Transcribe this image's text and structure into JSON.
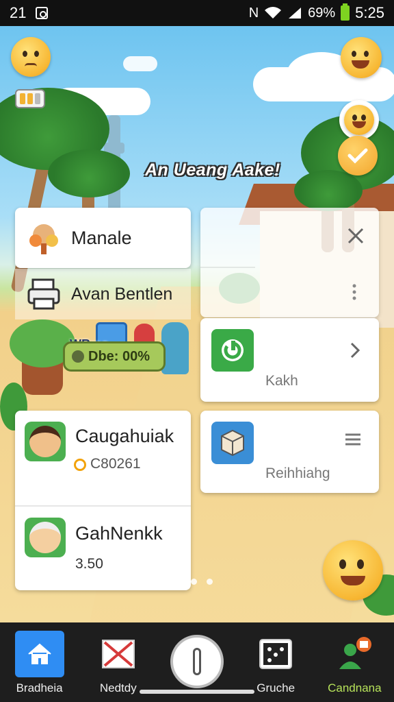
{
  "status_bar": {
    "left_text": "21",
    "battery": "69%",
    "time": "5:25"
  },
  "scene": {
    "headline": "An Ueang Aake!"
  },
  "menu": {
    "items": [
      {
        "label": "Manale"
      },
      {
        "label": "Avan Bentlen"
      }
    ],
    "card_overlay": {
      "tag": "WRmo",
      "pill_text": "Dbe: 00%"
    }
  },
  "apps": {
    "kakh": {
      "label": "Kakh"
    },
    "reihhiahg": {
      "label": "Reihhiahg"
    }
  },
  "contacts": [
    {
      "name": "Caugahuiak",
      "value": "C80261"
    },
    {
      "name": "GahNenkk",
      "value": "3.50"
    }
  ],
  "nav": {
    "items": [
      {
        "label": "Bradheia"
      },
      {
        "label": "Nedtdy"
      },
      {
        "label": "Gruche"
      },
      {
        "label": "Candnana"
      }
    ],
    "accent": "#2f8df3",
    "active_label_color": "#b7e35a"
  },
  "colors": {
    "sky": "#6ec4f0",
    "accent_green": "#3aa64a",
    "brand_blue": "#2f8df3"
  }
}
